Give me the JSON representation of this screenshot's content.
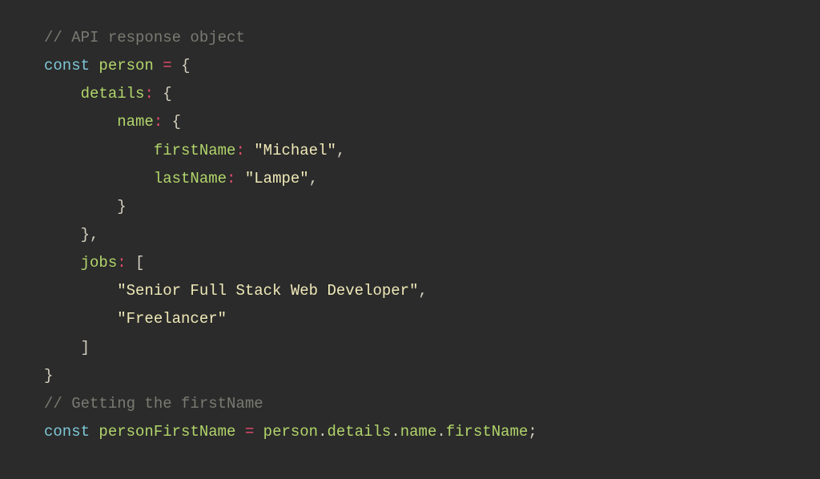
{
  "code": {
    "line1_comment": "// API response object",
    "line2_const": "const",
    "line2_var": "person",
    "line2_eq": "=",
    "line2_brace": "{",
    "line3_prop": "details",
    "line3_colon": ":",
    "line3_brace": "{",
    "line4_prop": "name",
    "line4_colon": ":",
    "line4_brace": "{",
    "line5_prop": "firstName",
    "line5_colon": ":",
    "line5_string": "\"Michael\"",
    "line5_comma": ",",
    "line6_prop": "lastName",
    "line6_colon": ":",
    "line6_string": "\"Lampe\"",
    "line6_comma": ",",
    "line7_brace": "}",
    "line8_brace": "}",
    "line8_comma": ",",
    "line9_prop": "jobs",
    "line9_colon": ":",
    "line9_bracket": "[",
    "line10_string": "\"Senior Full Stack Web Developer\"",
    "line10_comma": ",",
    "line11_string": "\"Freelancer\"",
    "line12_bracket": "]",
    "line13_brace": "}",
    "line14_comment": "// Getting the firstName",
    "line15_const": "const",
    "line15_var": "personFirstName",
    "line15_eq": "=",
    "line15_obj": "person",
    "line15_dot1": ".",
    "line15_p1": "details",
    "line15_dot2": ".",
    "line15_p2": "name",
    "line15_dot3": ".",
    "line15_p3": "firstName",
    "line15_semi": ";"
  }
}
